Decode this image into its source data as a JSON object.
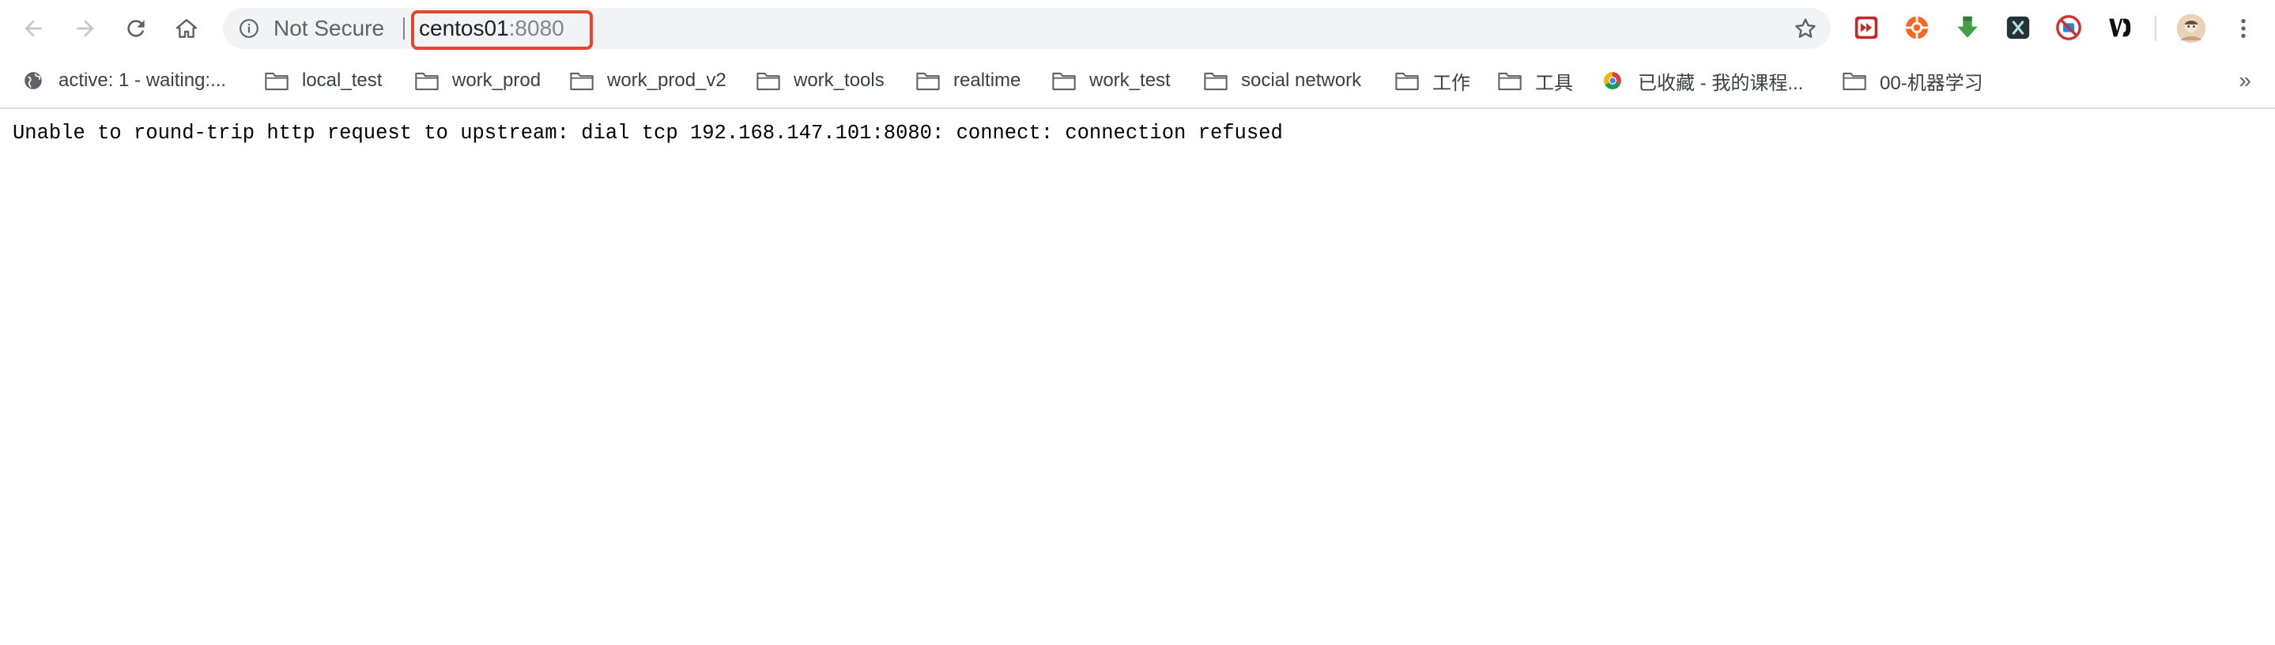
{
  "toolbar": {
    "back_icon": "arrow-left-icon",
    "forward_icon": "arrow-right-icon",
    "reload_icon": "reload-icon",
    "home_icon": "home-icon"
  },
  "omnibox": {
    "security_icon": "info-icon",
    "security_text": "Not Secure",
    "host": "centos01",
    "port": ":8080",
    "highlight_color": "#e8432d",
    "bookmark_icon": "star-icon"
  },
  "extensions": [
    {
      "name": "video-extension-icon",
      "color": "#c62828"
    },
    {
      "name": "orange-extension-icon",
      "color": "#f26a21"
    },
    {
      "name": "download-extension-icon",
      "color": "#43a047"
    },
    {
      "name": "x-extension-icon",
      "color": "#263238"
    },
    {
      "name": "red-circle-extension-icon",
      "color": "#d32f2f"
    },
    {
      "name": "vd-extension-icon",
      "color": "#111111"
    }
  ],
  "bookmarks": [
    {
      "label": "active: 1 - waiting:...",
      "icon": "globe-icon"
    },
    {
      "label": "local_test",
      "icon": "folder-icon"
    },
    {
      "label": "work_prod",
      "icon": "folder-icon"
    },
    {
      "label": "work_prod_v2",
      "icon": "folder-icon"
    },
    {
      "label": "work_tools",
      "icon": "folder-icon"
    },
    {
      "label": "realtime",
      "icon": "folder-icon"
    },
    {
      "label": "work_test",
      "icon": "folder-icon"
    },
    {
      "label": "social network",
      "icon": "folder-icon"
    },
    {
      "label": "工作",
      "icon": "folder-icon"
    },
    {
      "label": "工具",
      "icon": "folder-icon"
    },
    {
      "label": "已收藏 - 我的课程...",
      "icon": "chrome-store-icon"
    },
    {
      "label": "00-机器学习",
      "icon": "folder-icon"
    }
  ],
  "bookmarks_more": "»",
  "page": {
    "error_message": "Unable to round-trip http request to upstream: dial tcp 192.168.147.101:8080: connect: connection refused"
  }
}
